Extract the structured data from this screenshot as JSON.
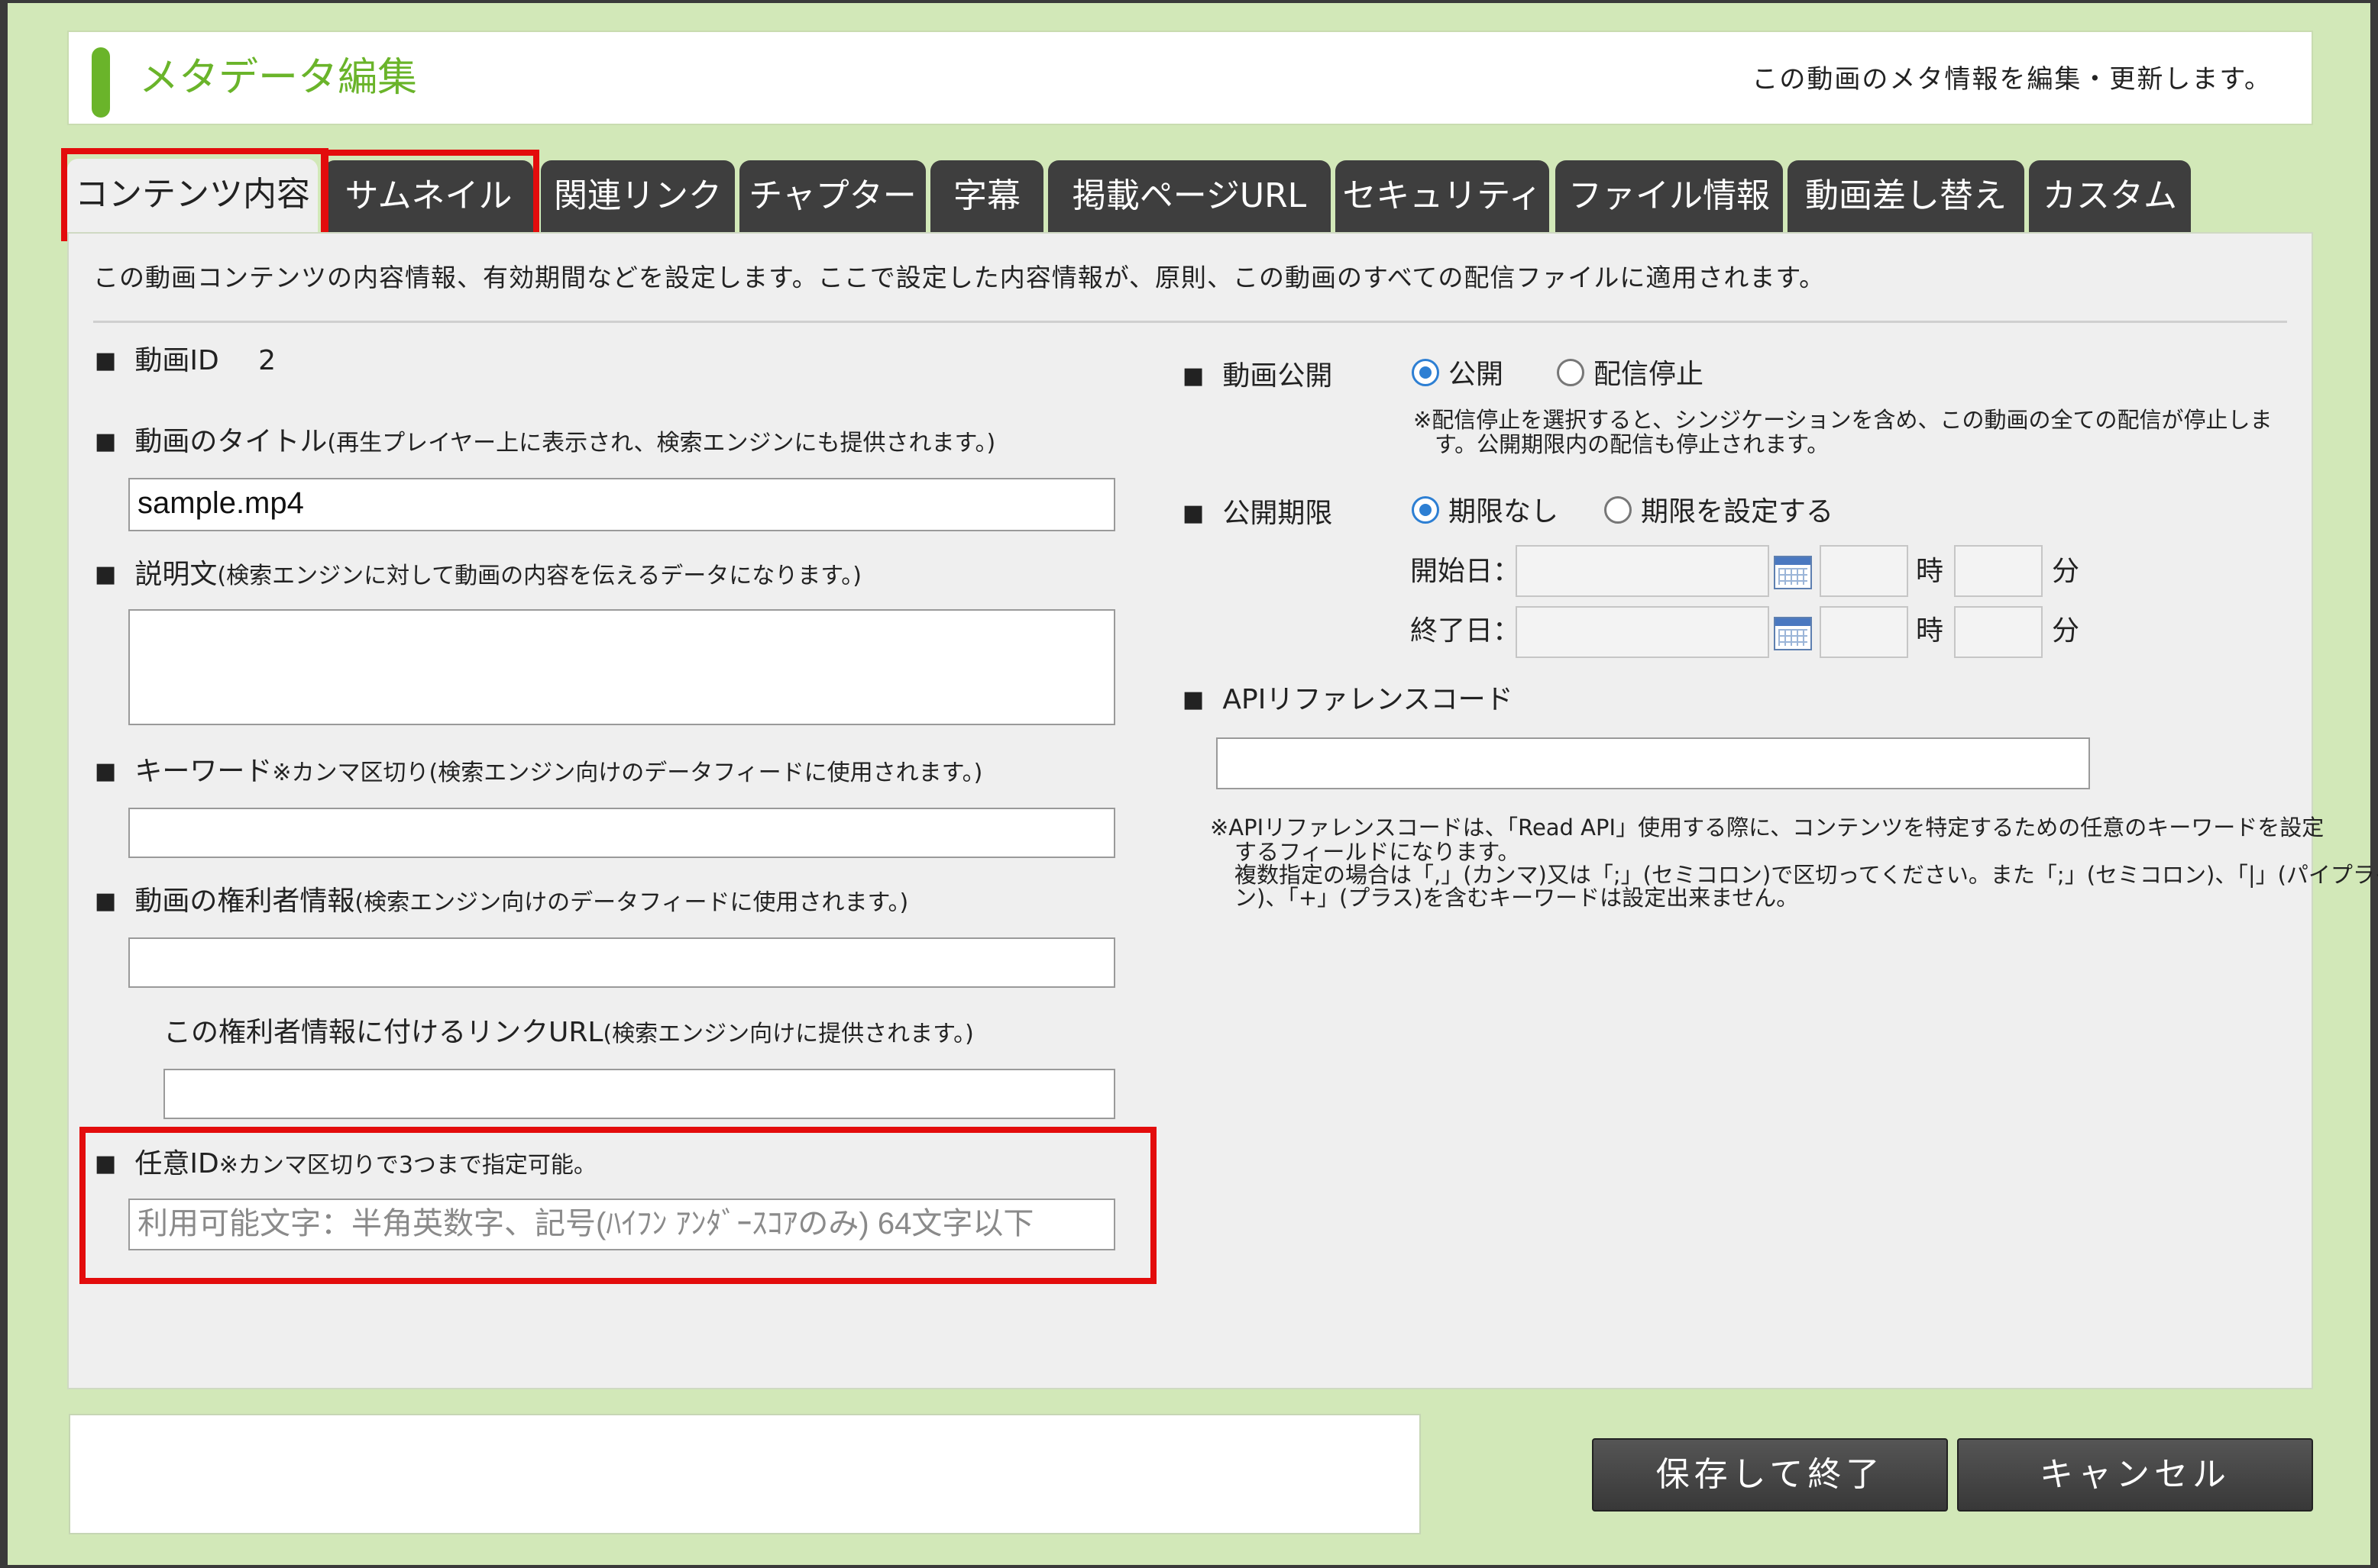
{
  "header": {
    "title": "メタデータ編集",
    "description": "この動画のメタ情報を編集・更新します。"
  },
  "tabs": [
    {
      "label": "コンテンツ内容",
      "active": true
    },
    {
      "label": "サムネイル",
      "active": false
    },
    {
      "label": "関連リンク",
      "active": false
    },
    {
      "label": "チャプター",
      "active": false
    },
    {
      "label": "字幕",
      "active": false
    },
    {
      "label": "掲載ページURL",
      "active": false
    },
    {
      "label": "セキュリティ",
      "active": false
    },
    {
      "label": "ファイル情報",
      "active": false
    },
    {
      "label": "動画差し替え",
      "active": false
    },
    {
      "label": "カスタム",
      "active": false
    }
  ],
  "intro": "この動画コンテンツの内容情報、有効期間などを設定します。ここで設定した内容情報が、原則、この動画のすべての配信ファイルに適用されます。",
  "left": {
    "video_id_label": "動画ID",
    "video_id_value": "2",
    "title_label": "動画のタイトル",
    "title_note": "(再生プレイヤー上に表示され、検索エンジンにも提供されます。)",
    "title_value": "sample.mp4",
    "description_label": "説明文",
    "description_note": "(検索エンジンに対して動画の内容を伝えるデータになります。)",
    "description_value": "",
    "keyword_label": "キーワード",
    "keyword_note": "※カンマ区切り(検索エンジン向けのデータフィードに使用されます。)",
    "keyword_value": "",
    "rights_label": "動画の権利者情報",
    "rights_note": "(検索エンジン向けのデータフィードに使用されます。)",
    "rights_value": "",
    "rights_link_label": "この権利者情報に付けるリンクURL",
    "rights_link_note": "(検索エンジン向けに提供されます。)",
    "rights_link_value": "",
    "custom_id_label": "任意ID",
    "custom_id_note": "※カンマ区切りで3つまで指定可能。",
    "custom_id_placeholder": "利用可能文字：半角英数字、記号(ﾊｲﾌﾝ ｱﾝﾀﾞｰｽｺｱのみ) 64文字以下"
  },
  "right": {
    "publish_label": "動画公開",
    "publish_options": [
      "公開",
      "配信停止"
    ],
    "publish_selected": "公開",
    "publish_note_1": "※配信停止を選択すると、シンジケーションを含め、この動画の全ての配信が停止しま",
    "publish_note_2": "す。公開期限内の配信も停止されます。",
    "period_label": "公開期限",
    "period_options": [
      "期限なし",
      "期限を設定する"
    ],
    "period_selected": "期限なし",
    "start_label": "開始日：",
    "end_label": "終了日：",
    "hour_unit": "時",
    "minute_unit": "分",
    "api_label": "APIリファレンスコード",
    "api_value": "",
    "api_note_1": "※APIリファレンスコードは、「Read API」使用する際に、コンテンツを特定するための任意のキーワードを設定",
    "api_note_2": "するフィールドになります。",
    "api_note_3": "複数指定の場合は「,」(カンマ)又は「;」(セミコロン)で区切ってください。また「;」(セミコロン)、「|」(パイプライ",
    "api_note_4": "ン)、「+」(プラス)を含むキーワードは設定出来ません。"
  },
  "buttons": {
    "save": "保存して終了",
    "cancel": "キャンセル"
  },
  "colors": {
    "background": "#d2e8b8",
    "accent_green": "#6ab42a",
    "tab_dark": "#3e3e3e",
    "highlight_red": "#e30c0c",
    "radio_blue": "#2d7fd3"
  }
}
